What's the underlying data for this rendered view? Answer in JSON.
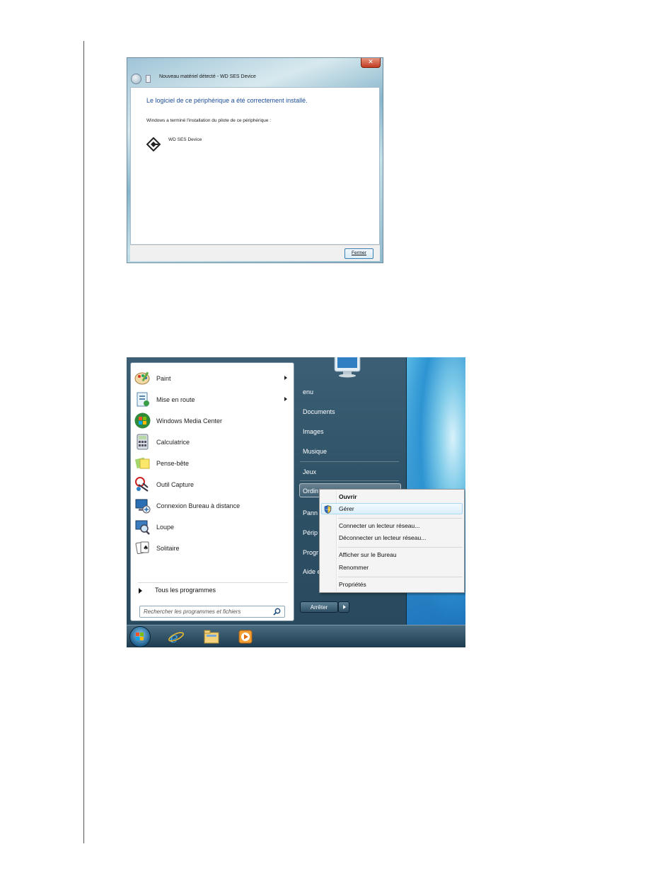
{
  "dialog": {
    "title": "Nouveau matériel détecté - WD SES Device",
    "close_glyph": "✕",
    "heading": "Le logiciel de ce périphérique a été correctement installé.",
    "description": "Windows a terminé l'installation du pilote de ce périphérique :",
    "device_name": "WD SES Device",
    "close_button": "Fermer"
  },
  "start_menu": {
    "programs": [
      {
        "label": "Paint",
        "icon": "paint-palette-icon",
        "has_submenu": true
      },
      {
        "label": "Mise en route",
        "icon": "getting-started-icon",
        "has_submenu": true
      },
      {
        "label": "Windows Media Center",
        "icon": "media-center-icon",
        "has_submenu": false
      },
      {
        "label": "Calculatrice",
        "icon": "calculator-icon",
        "has_submenu": false
      },
      {
        "label": "Pense-bête",
        "icon": "sticky-notes-icon",
        "has_submenu": false
      },
      {
        "label": "Outil Capture",
        "icon": "snipping-tool-icon",
        "has_submenu": false
      },
      {
        "label": "Connexion Bureau à distance",
        "icon": "remote-desktop-icon",
        "has_submenu": false
      },
      {
        "label": "Loupe",
        "icon": "magnifier-icon",
        "has_submenu": false
      },
      {
        "label": "Solitaire",
        "icon": "solitaire-icon",
        "has_submenu": false
      }
    ],
    "all_programs": "Tous les programmes",
    "search_placeholder": "Rechercher les programmes et fichiers",
    "right_items": [
      "enu",
      "Documents",
      "Images",
      "Musique",
      "Jeux",
      "Ordin",
      "Pann",
      "Périp",
      "Progr",
      "Aide e"
    ],
    "shutdown": "Arrêter"
  },
  "context_menu": {
    "items": [
      "Ouvrir",
      "Gérer",
      "Connecter un lecteur réseau...",
      "Déconnecter un lecteur réseau...",
      "Afficher sur le Bureau",
      "Renommer",
      "Propriétés"
    ],
    "default_item": "Ouvrir",
    "highlighted_item": "Gérer"
  },
  "taskbar": {
    "icons": [
      "start-orb-icon",
      "internet-explorer-icon",
      "explorer-folder-icon",
      "media-player-icon"
    ]
  },
  "colors": {
    "dialog_heading": "#1d4e9a",
    "menu_right_pane": "#2e5166",
    "desktop_blue": "#1c6fb5"
  }
}
